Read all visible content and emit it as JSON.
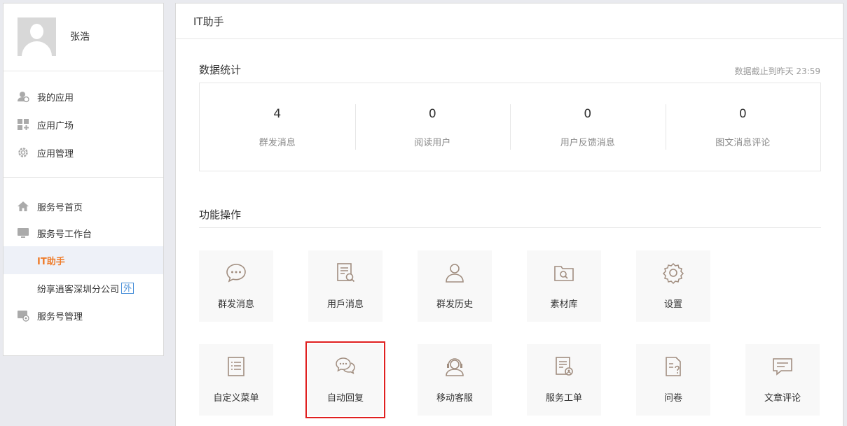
{
  "user": {
    "name": "张浩"
  },
  "sidebar": {
    "group1": [
      {
        "label": "我的应用",
        "icon": "user-app-icon"
      },
      {
        "label": "应用广场",
        "icon": "grid-icon"
      },
      {
        "label": "应用管理",
        "icon": "gear-icon"
      }
    ],
    "group2": {
      "home": {
        "label": "服务号首页",
        "icon": "home-icon"
      },
      "workbench": {
        "label": "服务号工作台",
        "icon": "monitor-icon"
      },
      "sub_items": [
        {
          "label": "IT助手"
        },
        {
          "label": "纷享逍客深圳分公司",
          "badge": "外"
        }
      ],
      "manage": {
        "label": "服务号管理",
        "icon": "manage-icon"
      }
    }
  },
  "header": {
    "title": "IT助手"
  },
  "stats": {
    "title": "数据统计",
    "note": "数据截止到昨天 23:59",
    "items": [
      {
        "value": "4",
        "label": "群发消息"
      },
      {
        "value": "0",
        "label": "阅读用户"
      },
      {
        "value": "0",
        "label": "用户反馈消息"
      },
      {
        "value": "0",
        "label": "图文消息评论"
      }
    ]
  },
  "functions": {
    "title": "功能操作",
    "row1": [
      {
        "label": "群发消息",
        "icon": "chat-bubble-icon"
      },
      {
        "label": "用戶消息",
        "icon": "document-search-icon"
      },
      {
        "label": "群发历史",
        "icon": "person-icon"
      },
      {
        "label": "素材库",
        "icon": "folder-search-icon"
      },
      {
        "label": "设置",
        "icon": "gear-icon"
      }
    ],
    "row2": [
      {
        "label": "自定义菜单",
        "icon": "list-icon"
      },
      {
        "label": "自动回复",
        "icon": "chat-double-icon"
      },
      {
        "label": "移动客服",
        "icon": "headset-icon"
      },
      {
        "label": "服务工单",
        "icon": "ticket-icon"
      },
      {
        "label": "问卷",
        "icon": "question-doc-icon"
      },
      {
        "label": "文章评论",
        "icon": "comment-icon"
      }
    ]
  },
  "colors": {
    "accent": "#ef7c2a",
    "icon": "#a18e80",
    "highlight_border": "#e02020",
    "link": "#4a90d9"
  }
}
